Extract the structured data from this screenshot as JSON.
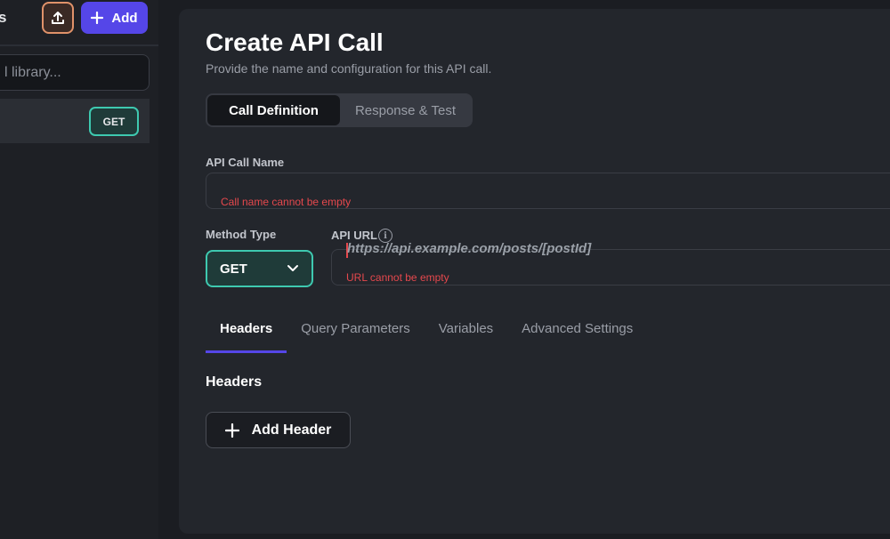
{
  "sidebar": {
    "title_fragment": "s",
    "add_label": "Add",
    "search_placeholder": "l library...",
    "item": {
      "method": "GET"
    }
  },
  "main": {
    "title": "Create API Call",
    "subtitle": "Provide the name and configuration for this API call.",
    "segments": [
      "Call Definition",
      "Response & Test"
    ],
    "call_name": {
      "label": "API Call Name",
      "value": "",
      "error": "Call name cannot be empty"
    },
    "method": {
      "label": "Method Type",
      "selected": "GET"
    },
    "url": {
      "label": "API URL",
      "value": "https://api.example.com/posts/[postId]",
      "error": "URL cannot be empty"
    },
    "tabs": [
      "Headers",
      "Query Parameters",
      "Variables",
      "Advanced Settings"
    ],
    "headers_section": {
      "heading": "Headers",
      "add_label": "Add Header"
    }
  },
  "colors": {
    "accent": "#5546e8",
    "method_teal": "#3ec9b0",
    "error": "#e5484d",
    "upload_orange": "#e0926a"
  }
}
